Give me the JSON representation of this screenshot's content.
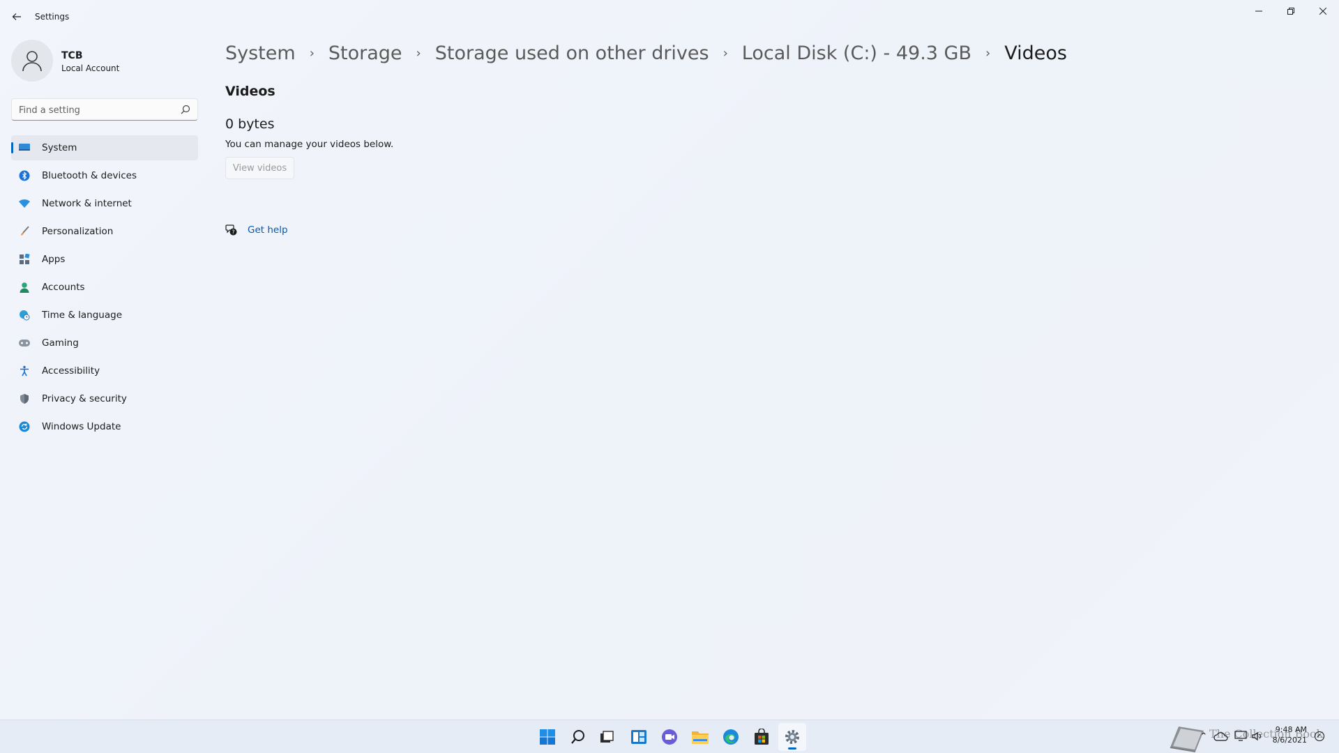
{
  "window": {
    "title": "Settings"
  },
  "profile": {
    "name": "TCB",
    "account_type": "Local Account"
  },
  "search": {
    "placeholder": "Find a setting"
  },
  "nav": {
    "items": [
      {
        "label": "System",
        "icon": "monitor-icon",
        "active": true
      },
      {
        "label": "Bluetooth & devices",
        "icon": "bluetooth-icon"
      },
      {
        "label": "Network & internet",
        "icon": "wifi-icon"
      },
      {
        "label": "Personalization",
        "icon": "paintbrush-icon"
      },
      {
        "label": "Apps",
        "icon": "apps-icon"
      },
      {
        "label": "Accounts",
        "icon": "person-icon"
      },
      {
        "label": "Time & language",
        "icon": "globe-clock-icon"
      },
      {
        "label": "Gaming",
        "icon": "gamepad-icon"
      },
      {
        "label": "Accessibility",
        "icon": "accessibility-icon"
      },
      {
        "label": "Privacy & security",
        "icon": "shield-icon"
      },
      {
        "label": "Windows Update",
        "icon": "update-icon"
      }
    ]
  },
  "breadcrumb": {
    "items": [
      "System",
      "Storage",
      "Storage used on other drives",
      "Local Disk (C:) - 49.3 GB",
      "Videos"
    ]
  },
  "content": {
    "section_title": "Videos",
    "size": "0 bytes",
    "description": "You can manage your videos below.",
    "view_button": "View videos",
    "help_label": "Get help"
  },
  "taskbar": {
    "icons": [
      "start-icon",
      "search-icon",
      "task-view-icon",
      "widgets-icon",
      "chat-icon",
      "file-explorer-icon",
      "edge-icon",
      "store-icon",
      "settings-icon"
    ],
    "watermark": "The Collection Book",
    "time": "9:48 AM",
    "date": "8/6/2021"
  },
  "colors": {
    "accent": "#0067c0",
    "link": "#0058b5",
    "background": "#eef2f8"
  }
}
